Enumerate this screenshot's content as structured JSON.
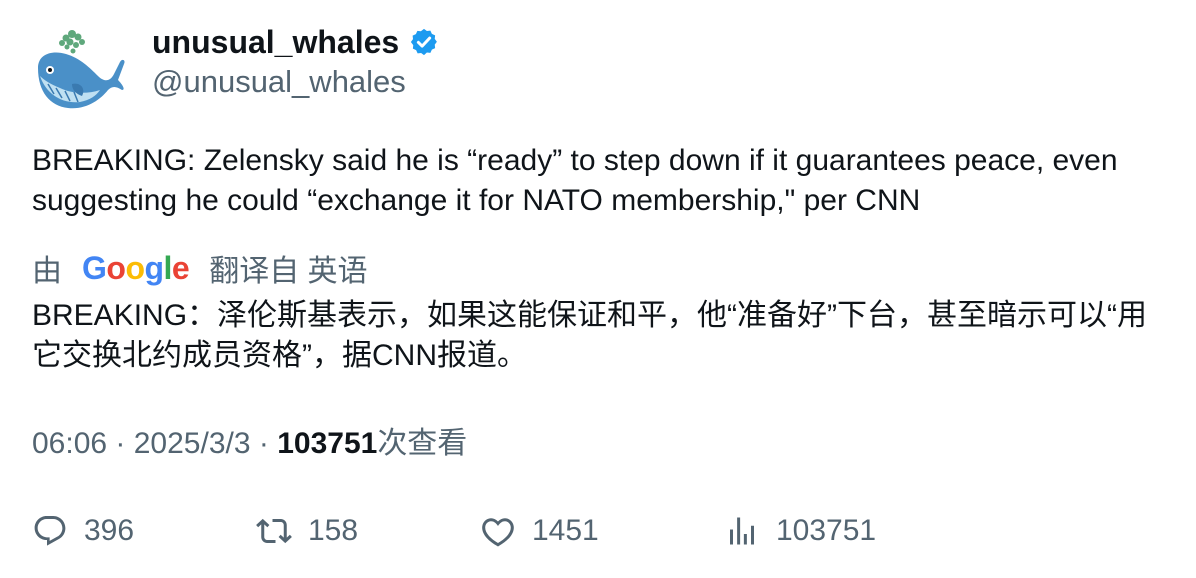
{
  "author": {
    "display_name": "unusual_whales",
    "handle": "@unusual_whales",
    "avatar_icon": "whale-logo-icon",
    "verified_icon": "verified-badge-icon",
    "verified_color": "#1d9bf0"
  },
  "tweet": {
    "text": "BREAKING: Zelensky said he is “ready” to step down if it guarantees peace, even suggesting he could “exchange it for NATO membership,\" per CNN"
  },
  "translation": {
    "by_label": "由",
    "provider_name": "Google",
    "from_label": "翻译自 英语",
    "text": "BREAKING：泽伦斯基表示，如果这能保证和平，他“准备好”下台，甚至暗示可以“用它交换北约成员资格”，据CNN报道。"
  },
  "meta": {
    "time": "06:06",
    "separator": "·",
    "date": "2025/3/3",
    "views": "103751",
    "views_label": "次查看"
  },
  "actions": {
    "replies": "396",
    "retweets": "158",
    "likes": "1451",
    "views": "103751"
  },
  "colors": {
    "text_primary": "#0f1419",
    "text_secondary": "#536471",
    "google_blue": "#4285f4",
    "google_red": "#ea4335",
    "google_yellow": "#fbbc05",
    "google_green": "#34a853"
  }
}
